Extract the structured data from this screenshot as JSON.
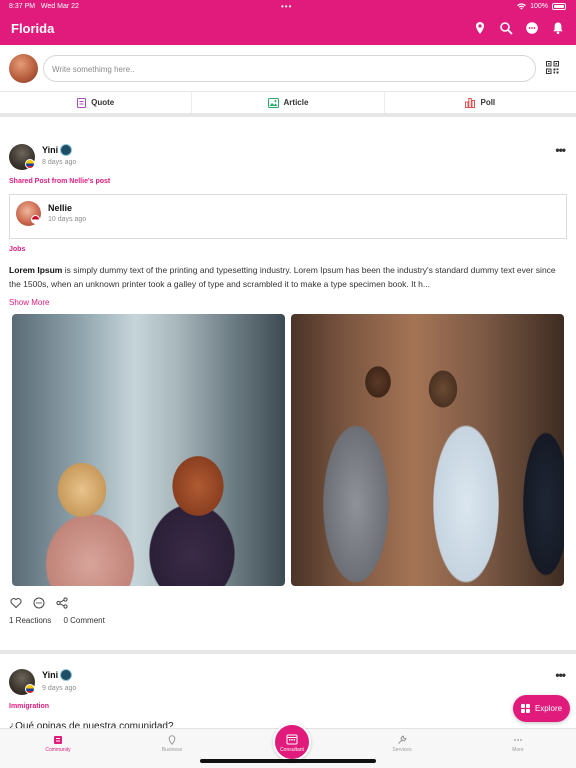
{
  "status_bar": {
    "time": "8:37 PM",
    "date": "Wed Mar 22",
    "battery": "100%"
  },
  "app_bar": {
    "title": "Florida"
  },
  "composer": {
    "placeholder": "Write somethimg here.."
  },
  "post_tabs": [
    {
      "label": "Quote",
      "icon": "quote-icon"
    },
    {
      "label": "Article",
      "icon": "article-icon"
    },
    {
      "label": "Poll",
      "icon": "poll-icon"
    }
  ],
  "post1": {
    "author": "Yini",
    "time": "8 days ago",
    "shared_from": "Shared Post from Nellie's post",
    "shared": {
      "author": "Nellie",
      "time": "10 days ago"
    },
    "category": "Jobs",
    "body_bold": "Lorem Ipsum",
    "body_rest": " is simply dummy text of the printing and typesetting industry. Lorem Ipsum has been the industry's standard dummy text ever since the 1500s, when an unknown printer took a galley of type and scrambled it to make a type specimen book. It h...",
    "show_more": "Show More",
    "reactions": "1 Reactions",
    "comments": "0 Comment"
  },
  "post2": {
    "author": "Yini",
    "time": "9 days ago",
    "category": "Immigration",
    "text": "¿Qué opinas de nuestra comunidad?"
  },
  "explore": {
    "label": "Explore"
  },
  "bottom_nav": {
    "community": "Community",
    "business": "Business",
    "consultant": "Consultant",
    "services": "Services",
    "more": "More"
  },
  "colors": {
    "brand": "#e01b7c"
  }
}
